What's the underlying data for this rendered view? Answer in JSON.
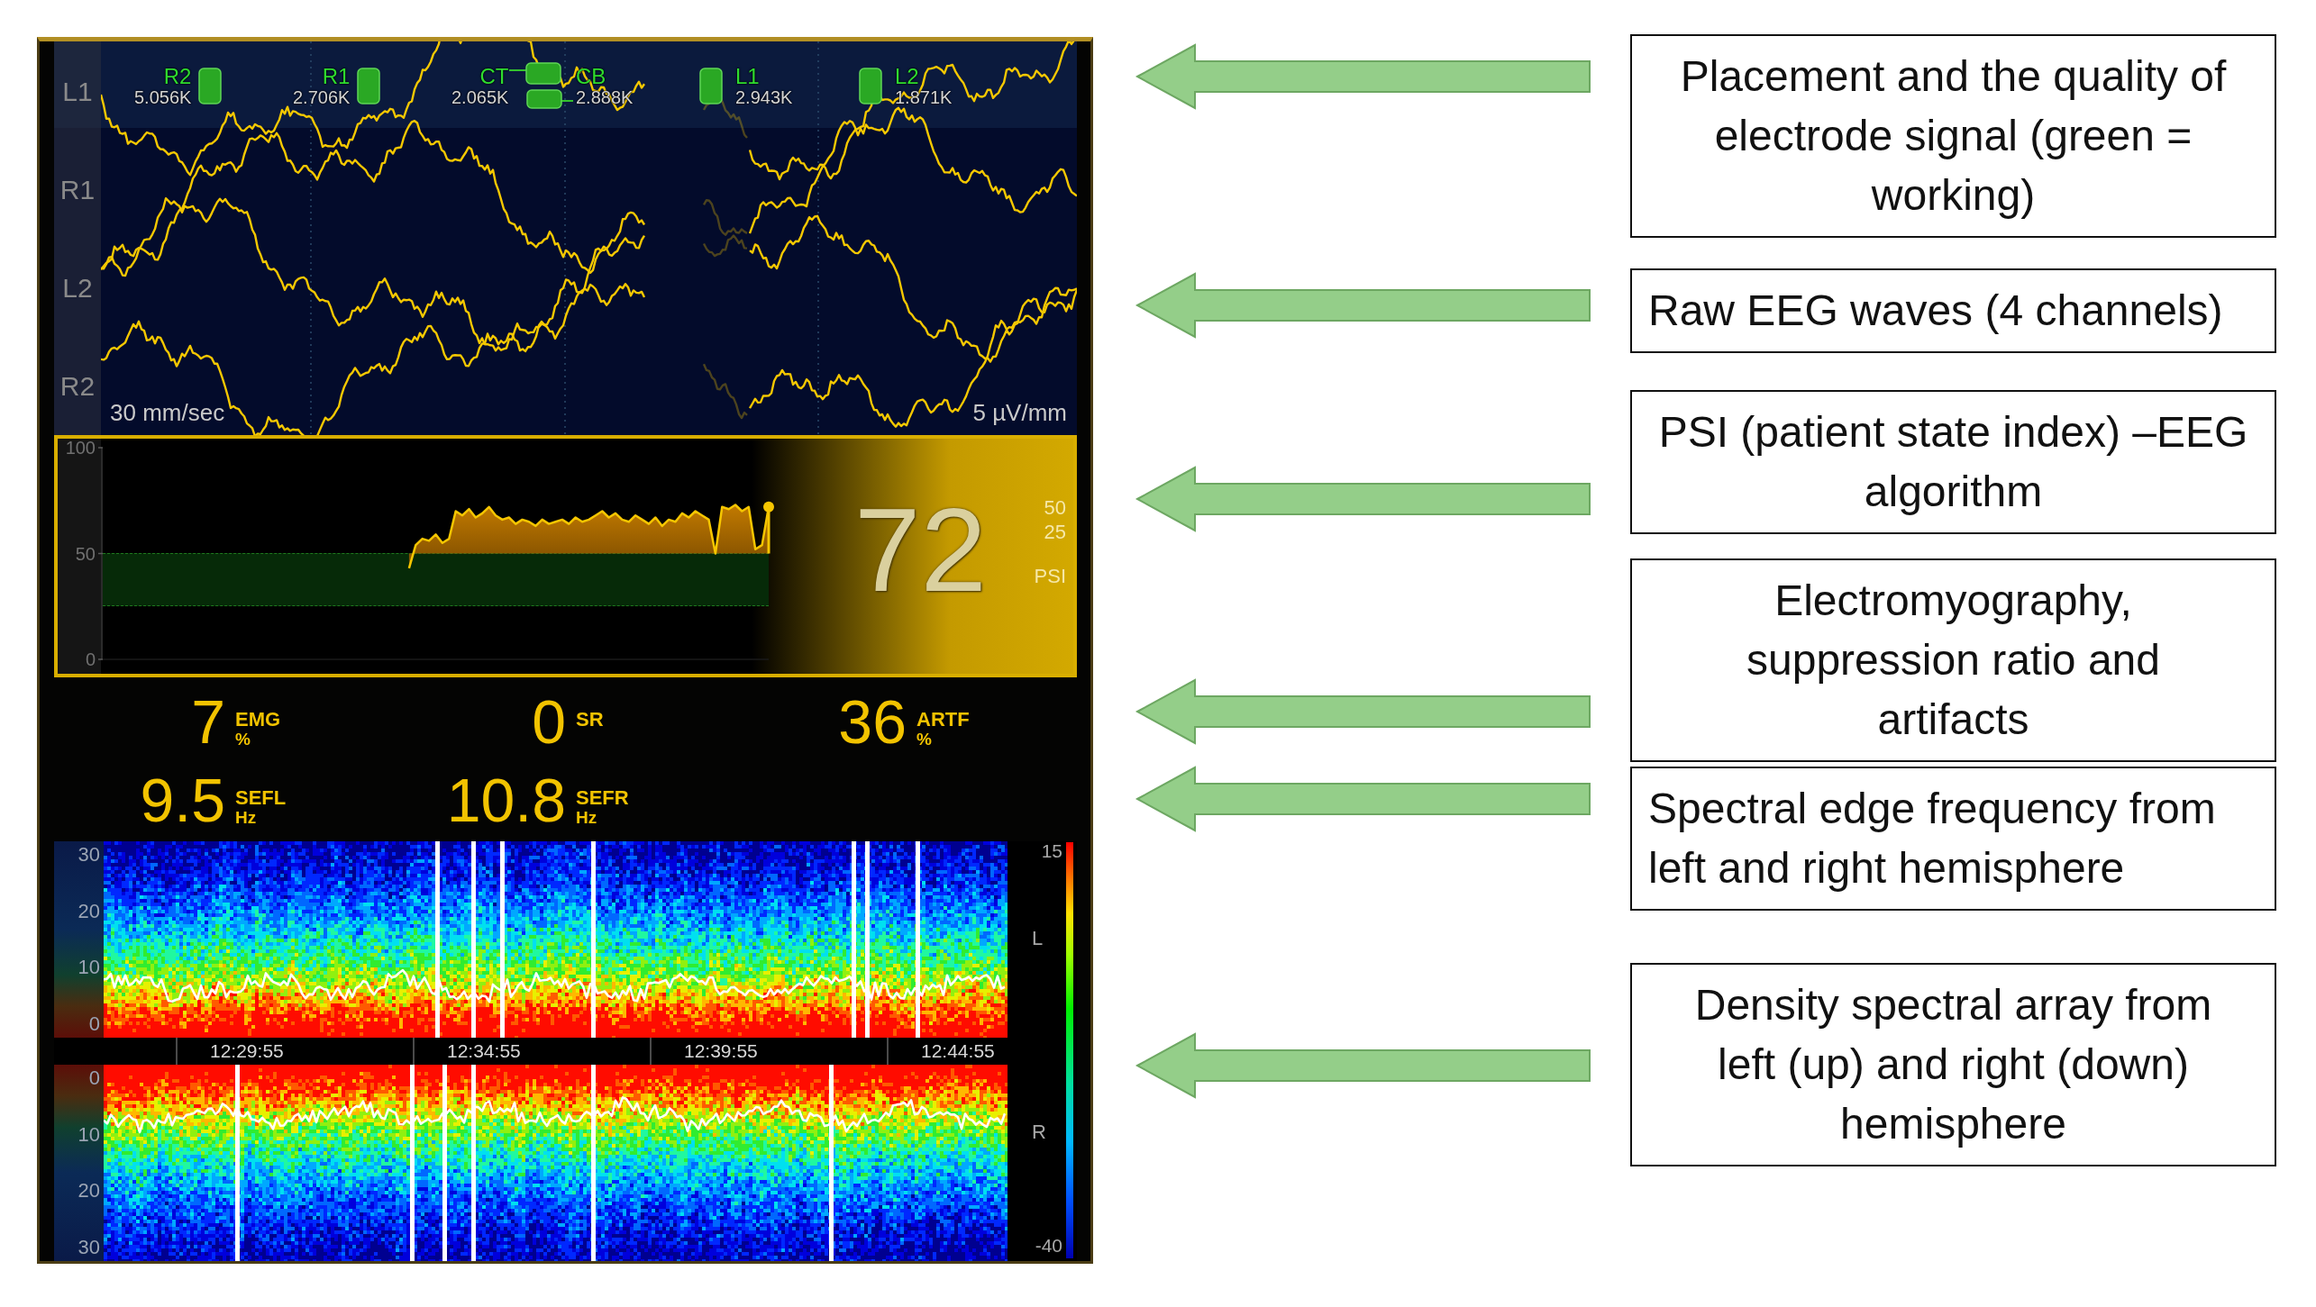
{
  "monitor": {
    "eeg": {
      "channels": [
        {
          "label": "L1"
        },
        {
          "label": "R1"
        },
        {
          "label": "L2"
        },
        {
          "label": "R2"
        }
      ],
      "electrodes": [
        {
          "name": "R2",
          "impedance": "5.056K",
          "working": true
        },
        {
          "name": "R1",
          "impedance": "2.706K",
          "working": true
        },
        {
          "name": "CT",
          "impedance": "2.065K",
          "working": true
        },
        {
          "name": "CB",
          "impedance": "2.888K",
          "working": true
        },
        {
          "name": "L1",
          "impedance": "2.943K",
          "working": true
        },
        {
          "name": "L2",
          "impedance": "1.871K",
          "working": true
        }
      ],
      "sweep_speed": "30 mm/sec",
      "amplitude_scale": "5 µV/mm"
    },
    "psi": {
      "chart_data": {
        "type": "area",
        "categories": [
          null,
          null,
          null,
          null,
          null,
          null,
          null,
          null,
          null,
          null,
          null,
          null,
          null,
          null,
          null,
          null,
          null,
          null,
          null,
          null,
          null,
          null,
          null,
          null,
          null,
          null,
          null,
          null,
          null,
          null,
          null,
          null,
          null,
          null,
          null,
          null,
          null,
          null,
          null,
          null,
          null,
          null,
          null,
          null,
          null,
          null,
          null,
          null,
          null,
          null,
          null,
          null,
          null,
          null,
          null,
          null,
          null,
          null,
          null,
          null,
          null,
          null,
          null,
          null,
          null,
          null,
          null,
          null,
          null,
          null,
          null,
          null,
          null,
          null,
          null,
          null,
          null,
          null,
          null,
          null,
          null,
          null,
          null,
          null,
          null,
          null,
          null,
          null,
          null,
          null,
          null,
          null,
          null,
          null,
          null,
          null,
          null,
          null,
          null,
          null,
          null
        ],
        "ylim": [
          0,
          100
        ],
        "yticks": [
          0,
          50,
          100
        ],
        "values": [
          null,
          null,
          null,
          null,
          null,
          null,
          null,
          null,
          null,
          null,
          null,
          null,
          null,
          null,
          null,
          null,
          null,
          null,
          null,
          null,
          null,
          null,
          null,
          null,
          null,
          null,
          null,
          null,
          null,
          null,
          null,
          null,
          null,
          null,
          null,
          null,
          null,
          null,
          null,
          null,
          null,
          null,
          null,
          null,
          null,
          null,
          43,
          54,
          57,
          56,
          59,
          55,
          57,
          70,
          68,
          71,
          67,
          69,
          72,
          68,
          66,
          67,
          64,
          66,
          65,
          63,
          66,
          64,
          65,
          66,
          64,
          67,
          65,
          66,
          68,
          70,
          67,
          69,
          66,
          65,
          68,
          66,
          64,
          67,
          63,
          66,
          65,
          69,
          67,
          70,
          68,
          66,
          50,
          72,
          71,
          73,
          70,
          72,
          52,
          54,
          72
        ]
      },
      "value": "72",
      "limits": [
        "50",
        "25"
      ],
      "label": "PSI"
    },
    "parameters": [
      {
        "value": "7",
        "label": "EMG",
        "unit": "%"
      },
      {
        "value": "0",
        "label": "SR"
      },
      {
        "value": "36",
        "label": "ARTF",
        "unit": "%"
      },
      {
        "value": "9.5",
        "label": "SEFL",
        "unit": "Hz"
      },
      {
        "value": "10.8",
        "label": "SEFR",
        "unit": "Hz"
      }
    ],
    "dsa": {
      "panels": [
        {
          "kind": "upright",
          "hemisphere": "L",
          "yticks": [
            "30",
            "20",
            "10",
            "0"
          ]
        },
        {
          "kind": "inverted",
          "hemisphere": "R",
          "yticks": [
            "0",
            "10",
            "20",
            "30"
          ]
        }
      ],
      "times": [
        "12:29:55",
        "12:34:55",
        "12:39:55",
        "12:44:55"
      ],
      "scale_max": "15",
      "scale_min": "-40"
    }
  },
  "callouts": [
    {
      "text": "Placement and the quality of\nelectrode signal (green =\nworking)"
    },
    {
      "text": "Raw EEG waves (4 channels)"
    },
    {
      "text": "PSI (patient state index) –EEG\nalgorithm"
    },
    {
      "text": "Electromyography,\nsuppression ratio and\nartifacts"
    },
    {
      "text": "Spectral edge frequency from\nleft and right hemisphere"
    },
    {
      "text": "Density spectral array from\nleft (up) and right (down)\nhemisphere"
    }
  ]
}
